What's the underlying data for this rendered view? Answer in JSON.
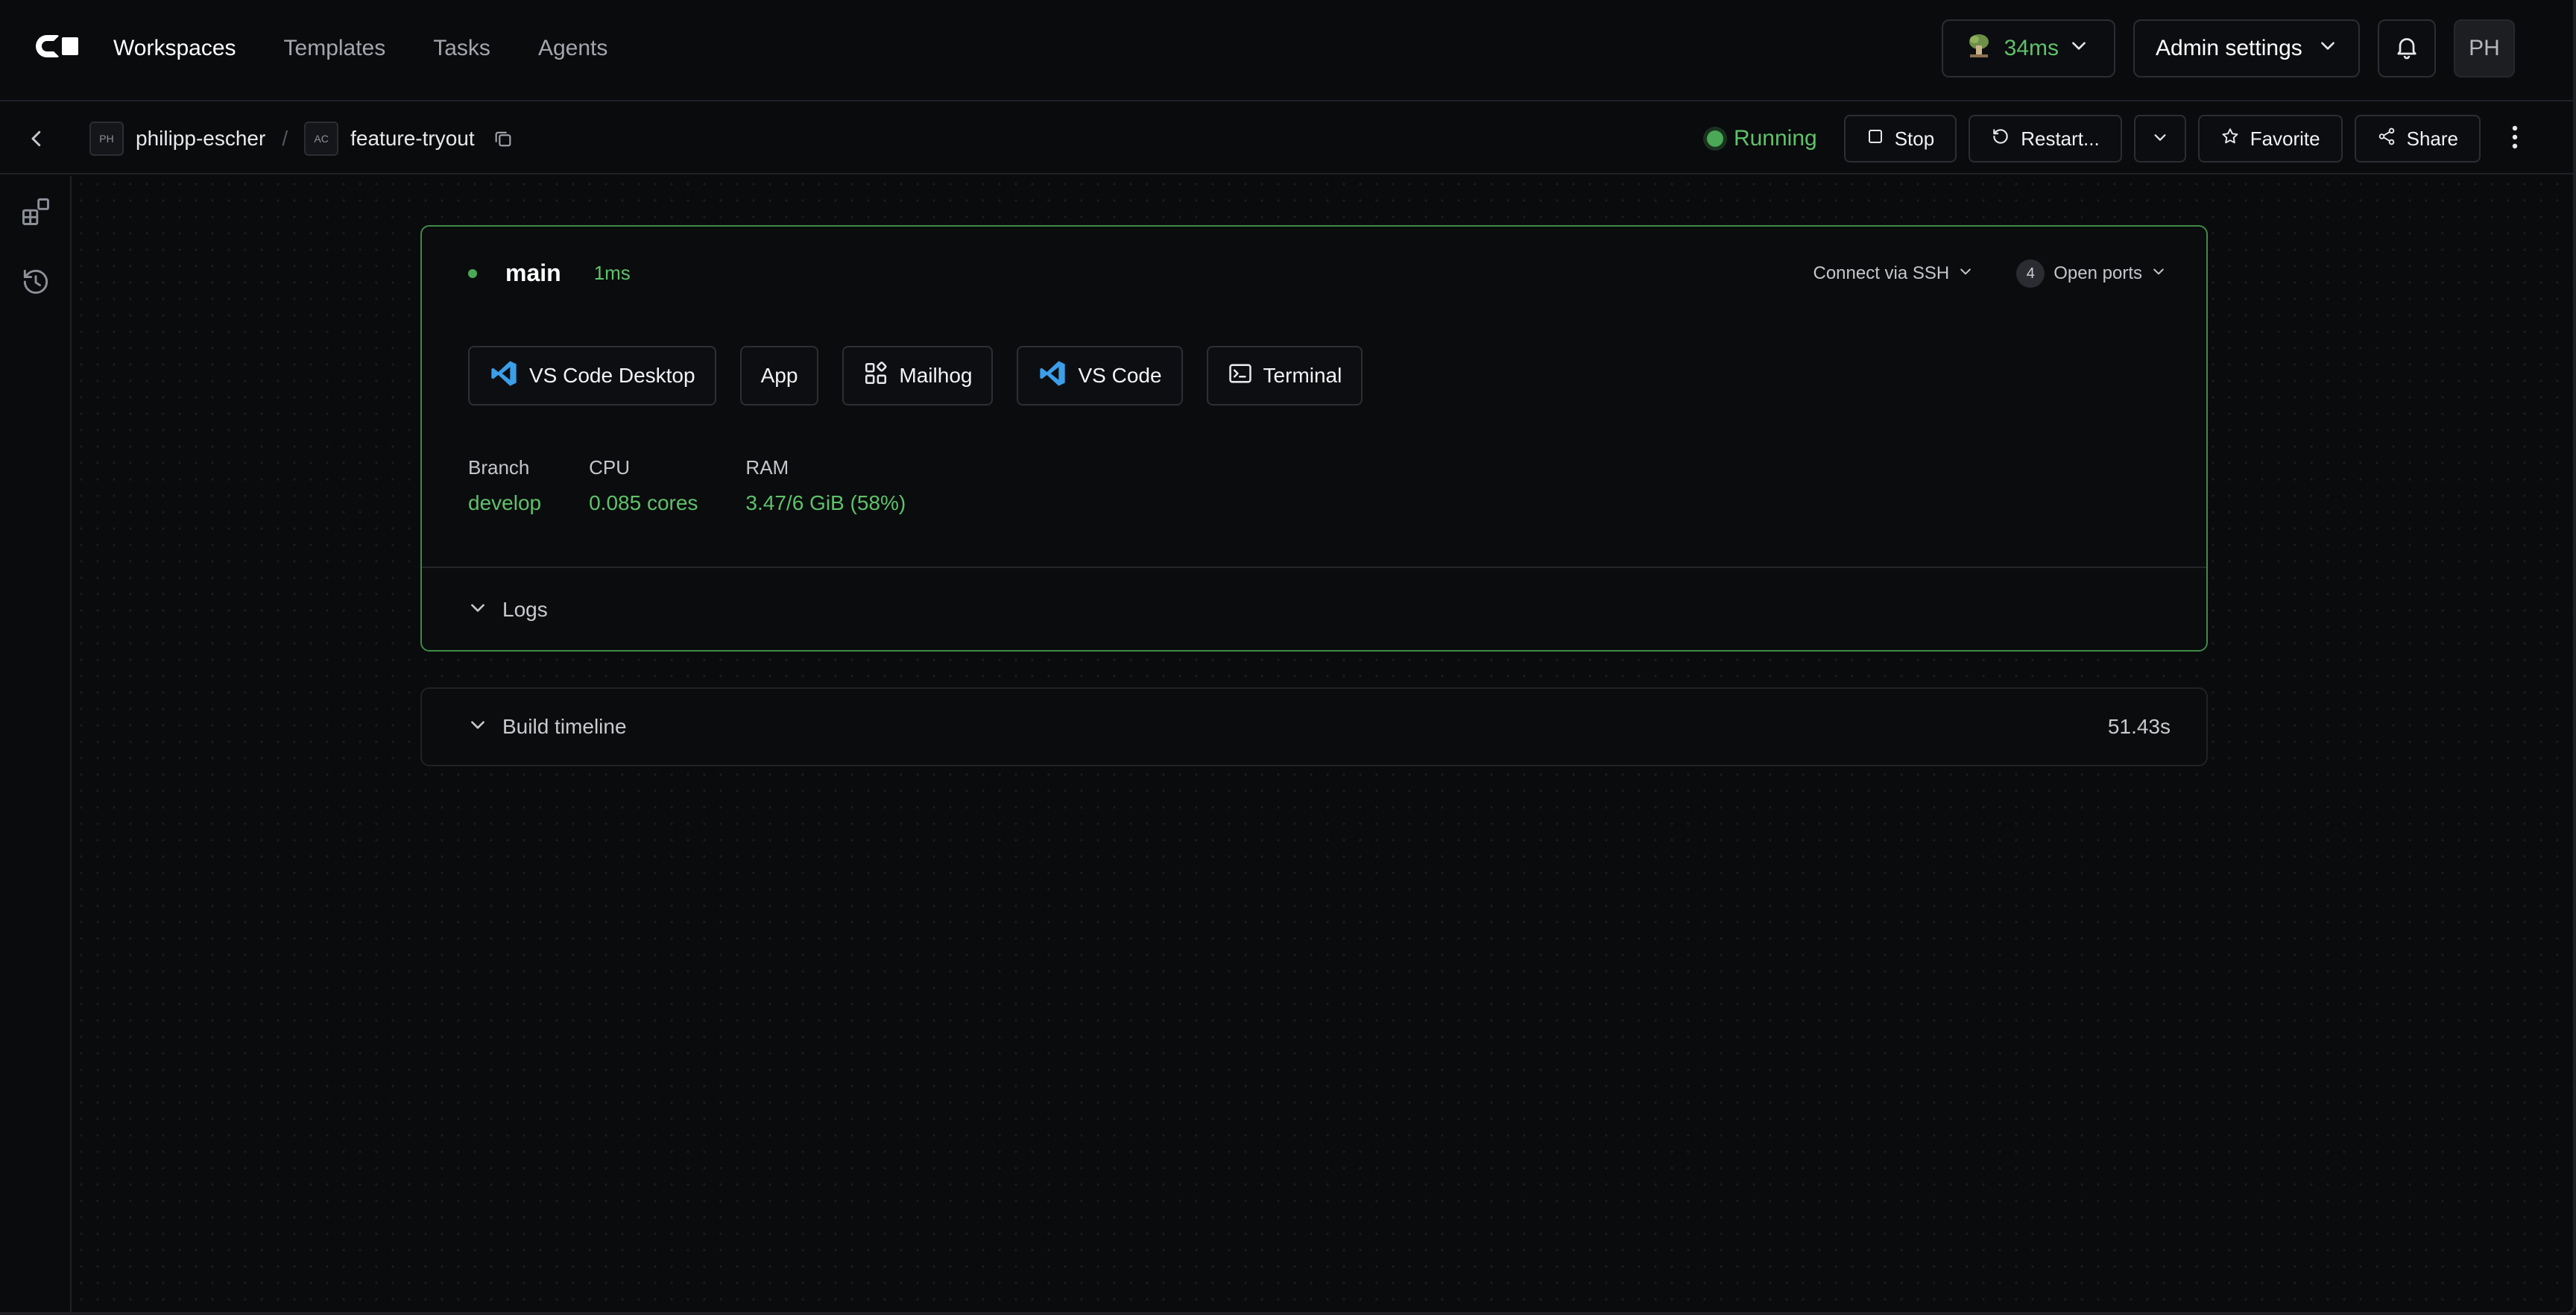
{
  "nav": {
    "links": [
      "Workspaces",
      "Templates",
      "Tasks",
      "Agents"
    ],
    "latency": "34ms",
    "admin_label": "Admin settings",
    "user_initials": "PH"
  },
  "subheader": {
    "owner_initials": "PH",
    "owner": "philipp-escher",
    "separator": "/",
    "workspace_initials": "AC",
    "workspace": "feature-tryout",
    "status": "Running",
    "stop_label": "Stop",
    "restart_label": "Restart...",
    "favorite_label": "Favorite",
    "share_label": "Share"
  },
  "agent": {
    "name": "main",
    "latency": "1ms",
    "ssh_label": "Connect via SSH",
    "open_ports_count": "4",
    "open_ports_label": "Open ports",
    "apps": [
      "VS Code Desktop",
      "App",
      "Mailhog",
      "VS Code",
      "Terminal"
    ],
    "stats": [
      {
        "label": "Branch",
        "value": "develop"
      },
      {
        "label": "CPU",
        "value": "0.085 cores"
      },
      {
        "label": "RAM",
        "value": "3.47/6 GiB (58%)"
      }
    ],
    "logs_label": "Logs"
  },
  "timeline": {
    "label": "Build timeline",
    "duration": "51.43s"
  },
  "colors": {
    "accent_green": "#5ec26a",
    "card_border": "#3f8a48",
    "background": "#0a0b0d",
    "vscode_blue": "#3b9ee8"
  }
}
